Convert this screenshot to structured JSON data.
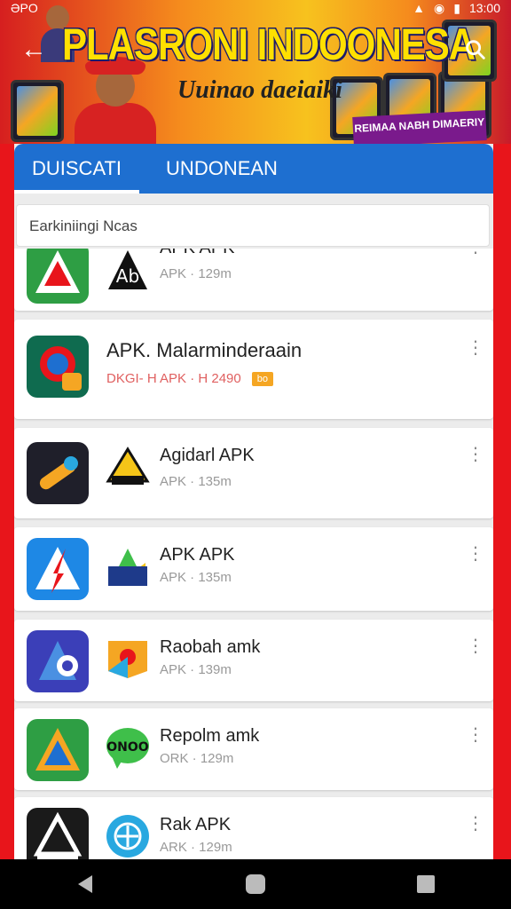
{
  "status_bar": {
    "carrier": "ƏPO",
    "time": "13:00"
  },
  "banner": {
    "title": "PLASRONI INDOONESA",
    "subtitle": "Uuinao daeiaiki",
    "badge": "REIMAA NABH DIMAERIY"
  },
  "tabs": [
    {
      "label": "DUISCATI"
    },
    {
      "label": "UNDONEAN"
    }
  ],
  "search": {
    "placeholder": "Earkiniingi Ncas"
  },
  "apps": [
    {
      "name": "APK APK",
      "meta": "APK · 129m",
      "icon1_color": "#2e9e44",
      "icon2_color": "#111111"
    },
    {
      "name": "APK. Malarminderaain",
      "meta": "DKGI- H APK · H 2490",
      "tag": "bo",
      "icon1_color": "#0f6b4f",
      "icon2_color": "#ffffff"
    },
    {
      "name": "Agidarl APK",
      "meta": "APK · 135m",
      "icon1_color": "#1f1f2a",
      "icon2_color": "#f5c518"
    },
    {
      "name": "APK APK",
      "meta": "APK · 135m",
      "icon1_color": "#1e88e5",
      "icon2_color": "#1e3a8a"
    },
    {
      "name": "Raobah amk",
      "meta": "APK · 139m",
      "icon1_color": "#3b3fb8",
      "icon2_color": "#f5a623"
    },
    {
      "name": "Repolm amk",
      "meta": "ORK · 129m",
      "icon1_color": "#2e9e44",
      "icon2_color": "#3fbf4a"
    },
    {
      "name": "Rak APK",
      "meta": "ARK · 129m",
      "icon1_color": "#1a1a1a",
      "icon2_color": "#29a8e0"
    }
  ],
  "nav": {
    "back": "back-icon",
    "home": "home-icon",
    "recents": "recents-icon"
  }
}
